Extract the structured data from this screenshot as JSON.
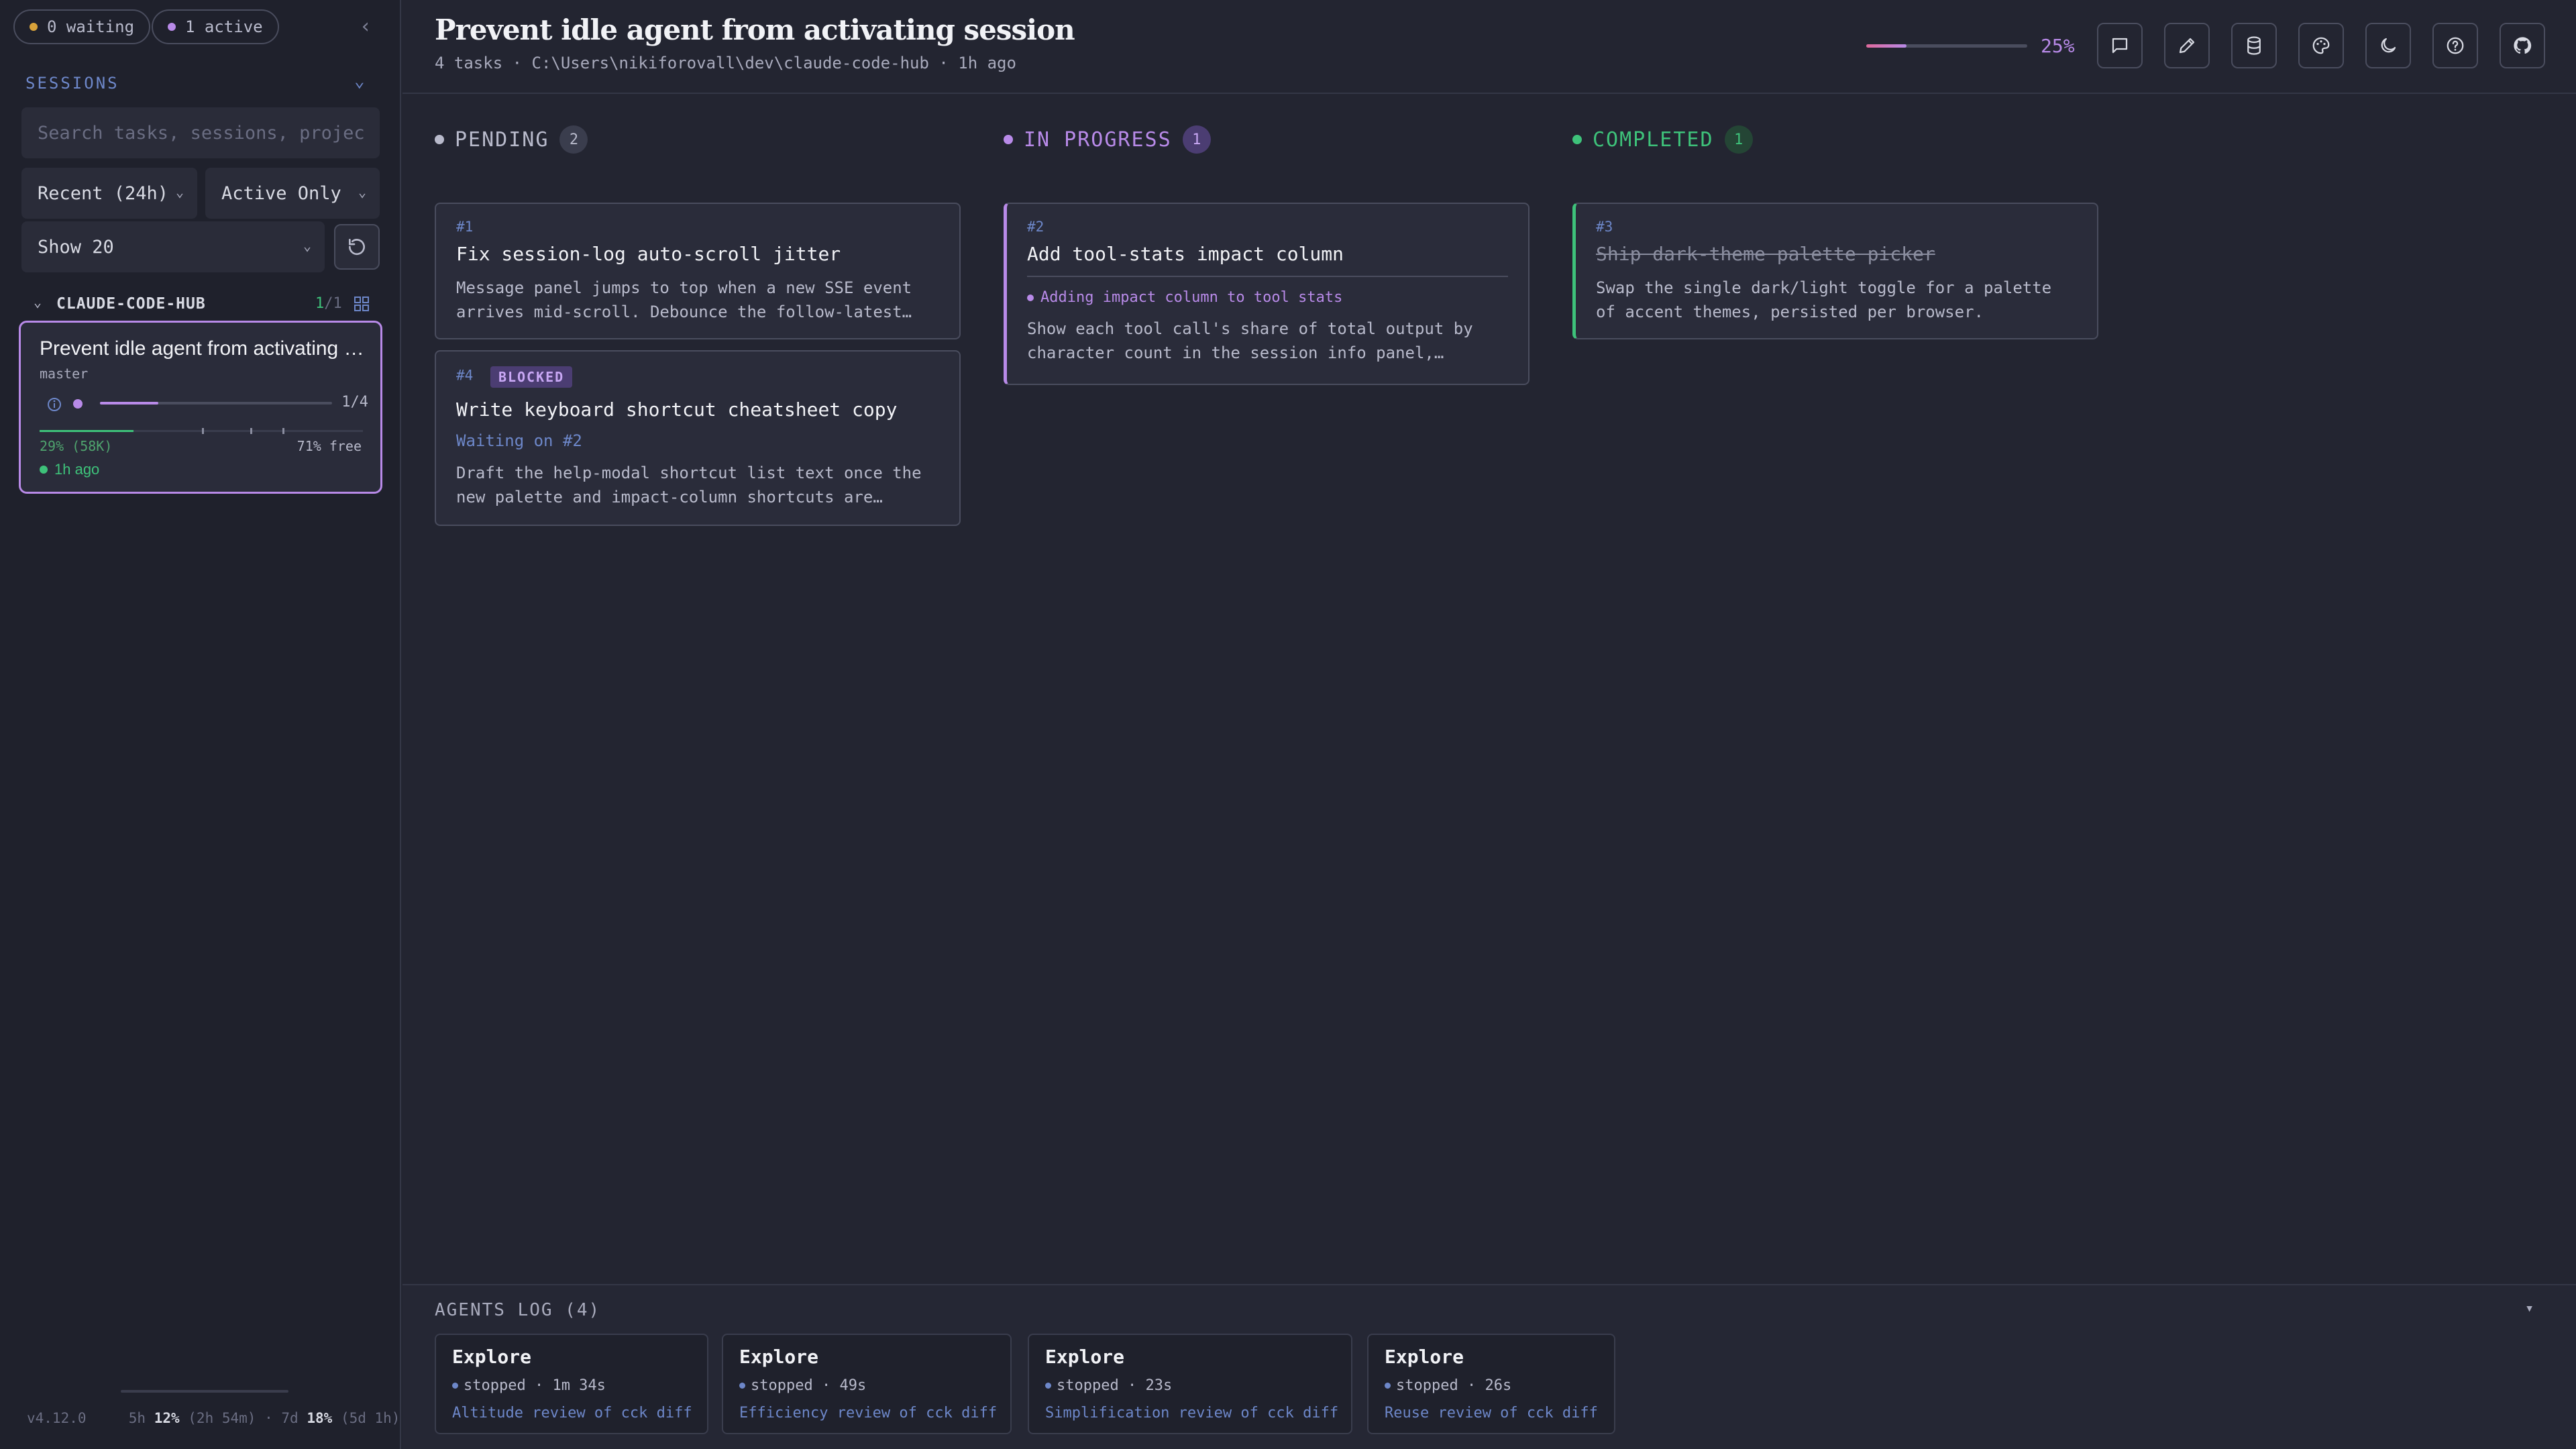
{
  "sidebar": {
    "waiting_label": "0 waiting",
    "active_label": "1 active",
    "collapse_icon": "chevron-left-icon",
    "sessions_header": "SESSIONS",
    "search_placeholder": "Search tasks, sessions, projects...",
    "filter_recent": "Recent (24h)",
    "filter_active": "Active Only",
    "show_count": "Show 20",
    "group": {
      "name": "CLAUDE-CODE-HUB",
      "count_active": "1",
      "count_sep": "/",
      "count_total": "1"
    },
    "session": {
      "title": "Prevent idle agent from activating session",
      "branch": "master",
      "progress_fraction": 0.25,
      "progress_label": "1/4",
      "context_used_fraction": 0.29,
      "context_used_label": "29% (58K)",
      "context_free_label": "71% free",
      "time": "1h ago"
    },
    "footer": {
      "version": "v4.12.0",
      "window5h_label": "5h",
      "window5h_pct": "12%",
      "window5h_reset": "(2h 54m)",
      "sep": "·",
      "window7d_label": "7d",
      "window7d_pct": "18%",
      "window7d_reset": "(5d 1h)"
    }
  },
  "header": {
    "title": "Prevent idle agent from activating session",
    "subtitle": "4 tasks · C:\\Users\\nikiforovall\\dev\\claude-code-hub · 1h ago",
    "progress_fraction": 0.25,
    "progress_label": "25%",
    "buttons": [
      "message-icon",
      "edit-icon",
      "database-icon",
      "palette-icon",
      "moon-icon",
      "help-icon",
      "github-icon"
    ]
  },
  "board": {
    "columns": [
      {
        "label": "PENDING",
        "count": "2",
        "color": "#b8bacb",
        "cards": [
          {
            "num": "#1",
            "title": "Fix session-log auto-scroll jitter",
            "desc": "Message panel jumps to top when a new SSE event arrives mid-scroll. Debounce the follow-latest re..."
          },
          {
            "num": "#4",
            "badge": "BLOCKED",
            "title": "Write keyboard shortcut cheatsheet copy",
            "waiting": "Waiting on #2",
            "desc": "Draft the help-modal shortcut list text once the new palette and impact-column shortcuts are…"
          }
        ]
      },
      {
        "label": "IN PROGRESS",
        "count": "1",
        "color": "#b88ae8",
        "cards": [
          {
            "num": "#2",
            "title": "Add tool-stats impact column",
            "activity": "Adding impact column to tool stats",
            "desc": "Show each tool call's share of total output by character count in the session info panel,…"
          }
        ]
      },
      {
        "label": "COMPLETED",
        "count": "1",
        "color": "#3ec27a",
        "cards": [
          {
            "num": "#3",
            "title": "Ship dark-theme palette picker",
            "desc": "Swap the single dark/light toggle for a palette of accent themes, persisted per browser."
          }
        ]
      }
    ]
  },
  "agents_log": {
    "title": "AGENTS LOG (4)",
    "toggle": "▾",
    "agents": [
      {
        "name": "Explore",
        "status": "stopped · 1m 34s",
        "desc": "Altitude review of cck diff"
      },
      {
        "name": "Explore",
        "status": "stopped · 49s",
        "desc": "Efficiency review of cck diff"
      },
      {
        "name": "Explore",
        "status": "stopped · 23s",
        "desc": "Simplification review of cck diff"
      },
      {
        "name": "Explore",
        "status": "stopped · 26s",
        "desc": "Reuse review of cck diff"
      }
    ]
  },
  "colors": {
    "accent": "#b88ae8",
    "success": "#3ec27a",
    "warning": "#d8a23a",
    "link": "#6d87c9"
  }
}
